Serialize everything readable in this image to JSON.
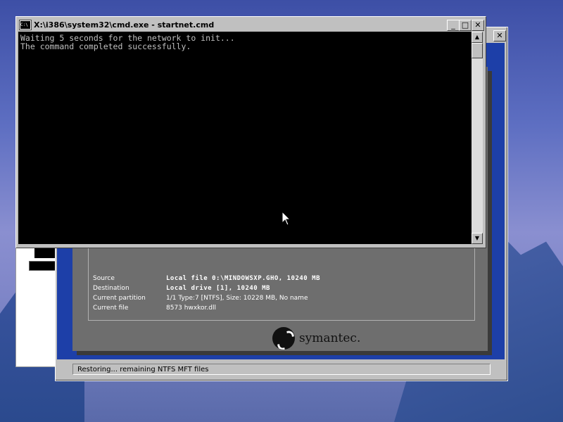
{
  "cmd_window": {
    "title": "X:\\i386\\system32\\cmd.exe - startnet.cmd",
    "icon_label": "C:\\",
    "console_lines": [
      "Waiting 5 seconds for the network to init...",
      "The command completed successfully."
    ],
    "buttons": {
      "minimize": "_",
      "maximize": "□",
      "close": "✕"
    }
  },
  "ghost_window": {
    "buttons": {
      "close": "✕"
    },
    "details": [
      {
        "key": "Source",
        "value": "Local file 0:\\MINDOWSXP.GHO, 10240 MB"
      },
      {
        "key": "Destination",
        "value": "Local drive [1], 10240 MB"
      },
      {
        "key": "Current partition",
        "value": "1/1 Type:7 [NTFS], Size: 10228 MB, No name"
      },
      {
        "key": "Current file",
        "value": "8573 hwxkor.dll"
      }
    ],
    "brand": "symantec.",
    "status_text": "Restoring... remaining NTFS MFT files"
  }
}
